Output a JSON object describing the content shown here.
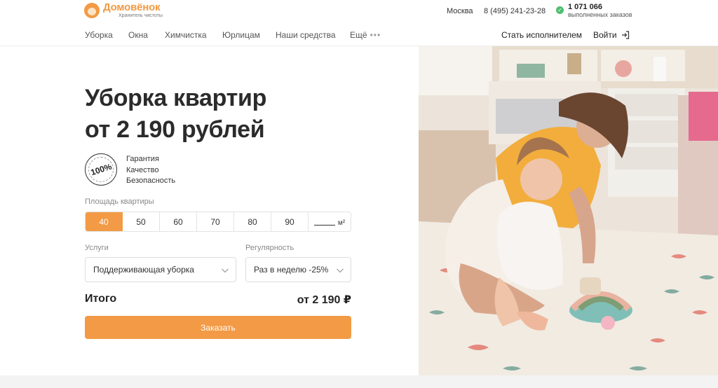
{
  "header": {
    "logo_name": "Домовёнок",
    "logo_tagline": "Хранитель чистоты",
    "city": "Москва",
    "phone": "8 (495) 241-23-28",
    "orders_count": "1 071 066",
    "orders_label": "выполненных заказов"
  },
  "nav": {
    "items": [
      "Уборка",
      "Окна",
      "Химчистка",
      "Юрлицам",
      "Наши средства",
      "Ещё"
    ],
    "become_performer": "Стать исполнителем",
    "login": "Войти"
  },
  "hero": {
    "title_line1": "Уборка квартир",
    "title_line2": "от 2 190 рублей",
    "badge": "100%",
    "features": [
      "Гарантия",
      "Качество",
      "Безопасность"
    ]
  },
  "calculator": {
    "area_label": "Площадь квартиры",
    "area_options": [
      "40",
      "50",
      "60",
      "70",
      "80",
      "90"
    ],
    "area_selected": "40",
    "area_unit": "м²",
    "services_label": "Услуги",
    "services_value": "Поддерживающая уборка",
    "regularity_label": "Регулярность",
    "regularity_value": "Раз в неделю -25%",
    "total_label": "Итого",
    "total_value": "от 2 190 ₽",
    "order_button": "Заказать"
  },
  "colors": {
    "accent": "#f29a45",
    "check": "#4fbf70"
  }
}
